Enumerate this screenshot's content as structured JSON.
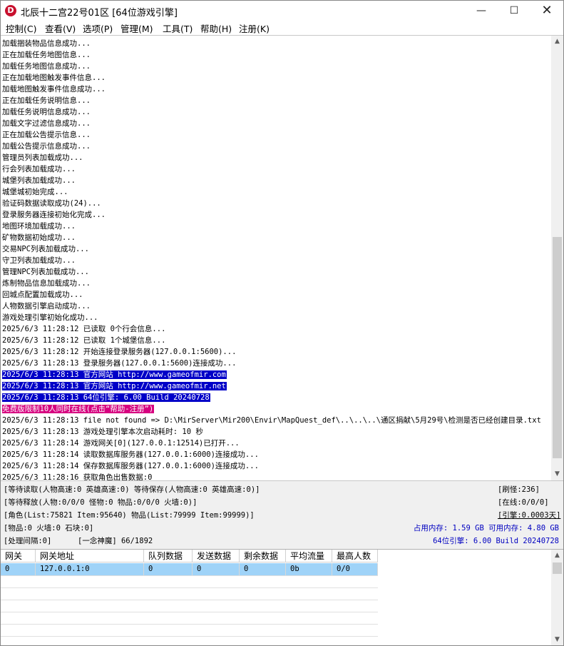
{
  "window": {
    "title": "北辰十二宫22号01区 [64位游戏引擎]",
    "icon_letter": "D"
  },
  "controls": {
    "minimize": "—",
    "maximize": "☐",
    "close": "✕"
  },
  "menu": [
    "控制(C)",
    "查看(V)",
    "选项(P)",
    "管理(M)",
    "工具(T)",
    "帮助(H)",
    "注册(K)"
  ],
  "log": [
    {
      "text": "加载捆装物品信息成功..."
    },
    {
      "text": "正在加载任务地图信息..."
    },
    {
      "text": "加载任务地图信息成功..."
    },
    {
      "text": "正在加载地图触发事件信息..."
    },
    {
      "text": "加载地图触发事件信息成功..."
    },
    {
      "text": "正在加载任务说明信息..."
    },
    {
      "text": "加载任务说明信息成功..."
    },
    {
      "text": "加载文字过滤信息成功..."
    },
    {
      "text": "正在加载公告提示信息..."
    },
    {
      "text": "加载公告提示信息成功..."
    },
    {
      "text": "管理员列表加载成功..."
    },
    {
      "text": "行会列表加载成功..."
    },
    {
      "text": "城堡列表加载成功..."
    },
    {
      "text": "城堡城初始完成..."
    },
    {
      "text": "验证码数据读取成功(24)..."
    },
    {
      "text": "登录服务器连接初始化完成..."
    },
    {
      "text": "地图环境加载成功..."
    },
    {
      "text": "矿物数据初始成功..."
    },
    {
      "text": "交易NPC列表加载成功..."
    },
    {
      "text": "守卫列表加载成功..."
    },
    {
      "text": "管理NPC列表加载成功..."
    },
    {
      "text": "炼制物品信息加载成功..."
    },
    {
      "text": "回城点配置加载成功..."
    },
    {
      "text": "人物数据引擎启动成功..."
    },
    {
      "text": "游戏处理引擎初始化成功..."
    },
    {
      "text": "2025/6/3 11:28:12 已读取 0个行会信息..."
    },
    {
      "text": "2025/6/3 11:28:12 已读取 1个城堡信息..."
    },
    {
      "text": "2025/6/3 11:28:12 开始连接登录服务器(127.0.0.1:5600)..."
    },
    {
      "text": "2025/6/3 11:28:13 登录服务器(127.0.0.1:5600)连接成功..."
    },
    {
      "text": "2025/6/3 11:28:13 官方网站 http://www.gameofmir.com",
      "hl": "blue"
    },
    {
      "text": "2025/6/3 11:28:13 官方网站 http://www.gameofmir.net",
      "hl": "blue"
    },
    {
      "text": "2025/6/3 11:28:13 64位引擎: 6.00 Build 20240728",
      "hl": "blue"
    },
    {
      "text": "免费版限制10人同时在线(点击“帮助-注册”)",
      "hl": "pink"
    },
    {
      "text": "2025/6/3 11:28:13 file not found => D:\\MirServer\\Mir200\\Envir\\MapQuest_def\\..\\..\\..\\通区捐献\\5月29号\\检测是否已经创建目录.txt"
    },
    {
      "text": "2025/6/3 11:28:13 游戏处理引擎本次启动耗时: 10 秒"
    },
    {
      "text": "2025/6/3 11:28:14 游戏网关[0](127.0.0.1:12514)已打开..."
    },
    {
      "text": "2025/6/3 11:28:14 读取数据库服务器(127.0.0.1:6000)连接成功..."
    },
    {
      "text": "2025/6/3 11:28:14 保存数据库服务器(127.0.0.1:6000)连接成功..."
    },
    {
      "text": "2025/6/3 11:28:16 获取角色出售数据:0"
    }
  ],
  "status": {
    "wait_read": "[等待读取(人物高速:0 英雄高速:0) 等待保存(人物高速:0 英雄高速:0)]",
    "refresh": "[刷怪:236]",
    "wait_release": "[等待释放(人物:0/0/0 怪物:0 物品:0/0/0 火墙:0)]",
    "online": "[在线:0/0/0]",
    "role": "[角色(List:75821 Item:95640) 物品(List:79999 Item:99999)]",
    "engine_time": "[引擎:0.0003天]",
    "items": "[物品:0 火墙:0 石块:0]",
    "memory": "占用内存: 1.59 GB 可用内存: 4.80 GB",
    "interval": "[处理间隔:0]",
    "shenmo": "[一念神魔] 66/1892",
    "build": "64位引擎: 6.00 Build 20240728"
  },
  "grid": {
    "columns": [
      "网关",
      "网关地址",
      "队列数据",
      "发送数据",
      "剩余数据",
      "平均流量",
      "最高人数"
    ],
    "rows": [
      [
        "0",
        "127.0.0.1:0",
        "0",
        "0",
        "0",
        "0b",
        "0/0"
      ]
    ]
  }
}
